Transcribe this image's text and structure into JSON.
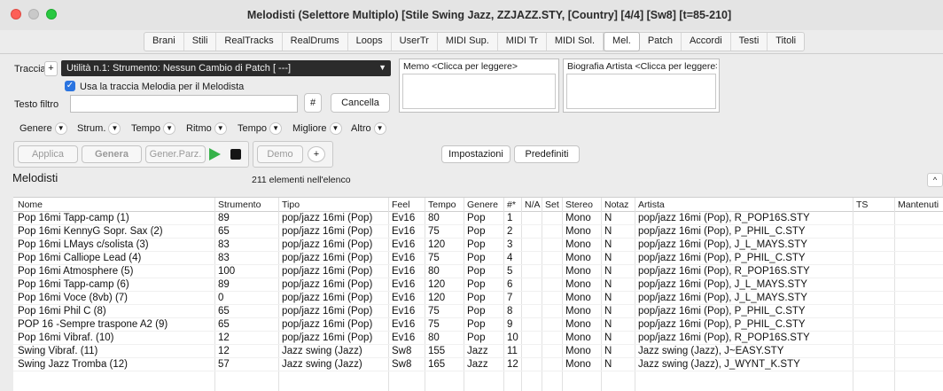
{
  "window": {
    "title": "Melodisti  (Selettore Multiplo)  [Stile Swing Jazz, ZZJAZZ.STY,  [Country] [4/4] [Sw8] [t=85-210]"
  },
  "tabs": [
    {
      "label": "Brani",
      "active": false
    },
    {
      "label": "Stili",
      "active": false
    },
    {
      "label": "RealTracks",
      "active": false
    },
    {
      "label": "RealDrums",
      "active": false
    },
    {
      "label": "Loops",
      "active": false
    },
    {
      "label": "UserTr",
      "active": false
    },
    {
      "label": "MIDI Sup.",
      "active": false
    },
    {
      "label": "MIDI Tr",
      "active": false
    },
    {
      "label": "MIDI Sol.",
      "active": false
    },
    {
      "label": "Mel.",
      "active": true
    },
    {
      "label": "Patch",
      "active": false
    },
    {
      "label": "Accordi",
      "active": false
    },
    {
      "label": "Testi",
      "active": false
    },
    {
      "label": "Titoli",
      "active": false
    }
  ],
  "track": {
    "label": "Traccia",
    "add_label": "+",
    "selected": "Utilità n.1: Strumento: Nessun Cambio di Patch [ ---]",
    "use_melody_label": "Usa la traccia Melodia per il Melodista",
    "use_melody_checked": true
  },
  "filter": {
    "label": "Testo filtro",
    "value": "",
    "hash_label": "#",
    "clear_label": "Cancella"
  },
  "memo": {
    "text": "Memo  <Clicca per leggere>"
  },
  "bio": {
    "text": "Biografia Artista <Clicca per leggere>"
  },
  "filters": [
    {
      "label": "Genere"
    },
    {
      "label": "Strum."
    },
    {
      "label": "Tempo"
    },
    {
      "label": "Ritmo"
    },
    {
      "label": "Tempo"
    },
    {
      "label": "Migliore"
    },
    {
      "label": "Altro"
    }
  ],
  "actions": {
    "apply": "Applica",
    "generate": "Genera",
    "gen_partial": "Gener.Parz.",
    "demo": "Demo",
    "plus": "+",
    "settings": "Impostazioni",
    "defaults": "Predefiniti"
  },
  "list": {
    "title": "Melodisti",
    "count": "211 elementi nell'elenco",
    "collapse": "^",
    "columns": [
      "Nome",
      "Strumento",
      "Tipo",
      "Feel",
      "Tempo",
      "Genere",
      "#*",
      "N/A",
      "Set",
      "Stereo",
      "Notaz",
      "Artista",
      "TS",
      "Mantenuti"
    ],
    "rows": [
      [
        "Pop 16mi Tapp-camp  (1)",
        "89",
        "pop/jazz 16mi (Pop)",
        "Ev16",
        "80",
        "Pop",
        "1",
        "",
        "",
        "Mono",
        "N",
        "pop/jazz 16mi (Pop), R_POP16S.STY"
      ],
      [
        "Pop 16mi KennyG Sopr. Sax  (2)",
        "65",
        "pop/jazz 16mi (Pop)",
        "Ev16",
        "75",
        "Pop",
        "2",
        "",
        "",
        "Mono",
        "N",
        "pop/jazz 16mi (Pop), P_PHIL_C.STY"
      ],
      [
        "Pop 16mi LMays c/solista  (3)",
        "83",
        "pop/jazz 16mi (Pop)",
        "Ev16",
        "120",
        "Pop",
        "3",
        "",
        "",
        "Mono",
        "N",
        "pop/jazz 16mi (Pop), J_L_MAYS.STY"
      ],
      [
        "Pop 16mi Calliope Lead  (4)",
        "83",
        "pop/jazz 16mi (Pop)",
        "Ev16",
        "75",
        "Pop",
        "4",
        "",
        "",
        "Mono",
        "N",
        "pop/jazz 16mi (Pop), P_PHIL_C.STY"
      ],
      [
        "Pop 16mi Atmosphere  (5)",
        "100",
        "pop/jazz 16mi (Pop)",
        "Ev16",
        "80",
        "Pop",
        "5",
        "",
        "",
        "Mono",
        "N",
        "pop/jazz 16mi (Pop), R_POP16S.STY"
      ],
      [
        "Pop 16mi Tapp-camp  (6)",
        "89",
        "pop/jazz 16mi (Pop)",
        "Ev16",
        "120",
        "Pop",
        "6",
        "",
        "",
        "Mono",
        "N",
        "pop/jazz 16mi (Pop), J_L_MAYS.STY"
      ],
      [
        "Pop 16mi Voce (8vb)  (7)",
        "0",
        "pop/jazz 16mi (Pop)",
        "Ev16",
        "120",
        "Pop",
        "7",
        "",
        "",
        "Mono",
        "N",
        "pop/jazz 16mi (Pop), J_L_MAYS.STY"
      ],
      [
        "Pop 16mi Phil C  (8)",
        "65",
        "pop/jazz 16mi (Pop)",
        "Ev16",
        "75",
        "Pop",
        "8",
        "",
        "",
        "Mono",
        "N",
        "pop/jazz 16mi (Pop), P_PHIL_C.STY"
      ],
      [
        "POP 16 -Sempre traspone A2  (9)",
        "65",
        "pop/jazz 16mi (Pop)",
        "Ev16",
        "75",
        "Pop",
        "9",
        "",
        "",
        "Mono",
        "N",
        "pop/jazz 16mi (Pop), P_PHIL_C.STY"
      ],
      [
        "Pop 16mi Vibraf.  (10)",
        "12",
        "pop/jazz 16mi (Pop)",
        "Ev16",
        "80",
        "Pop",
        "10",
        "",
        "",
        "Mono",
        "N",
        "pop/jazz 16mi (Pop), R_POP16S.STY"
      ],
      [
        "Swing Vibraf.  (11)",
        "12",
        "Jazz swing (Jazz)",
        "Sw8",
        "155",
        "Jazz",
        "11",
        "",
        "",
        "Mono",
        "N",
        "Jazz swing (Jazz), J~EASY.STY"
      ],
      [
        "Swing Jazz Tromba  (12)",
        "57",
        "Jazz swing (Jazz)",
        "Sw8",
        "165",
        "Jazz",
        "12",
        "",
        "",
        "Mono",
        "N",
        "Jazz swing (Jazz), J_WYNT_K.STY"
      ]
    ]
  }
}
